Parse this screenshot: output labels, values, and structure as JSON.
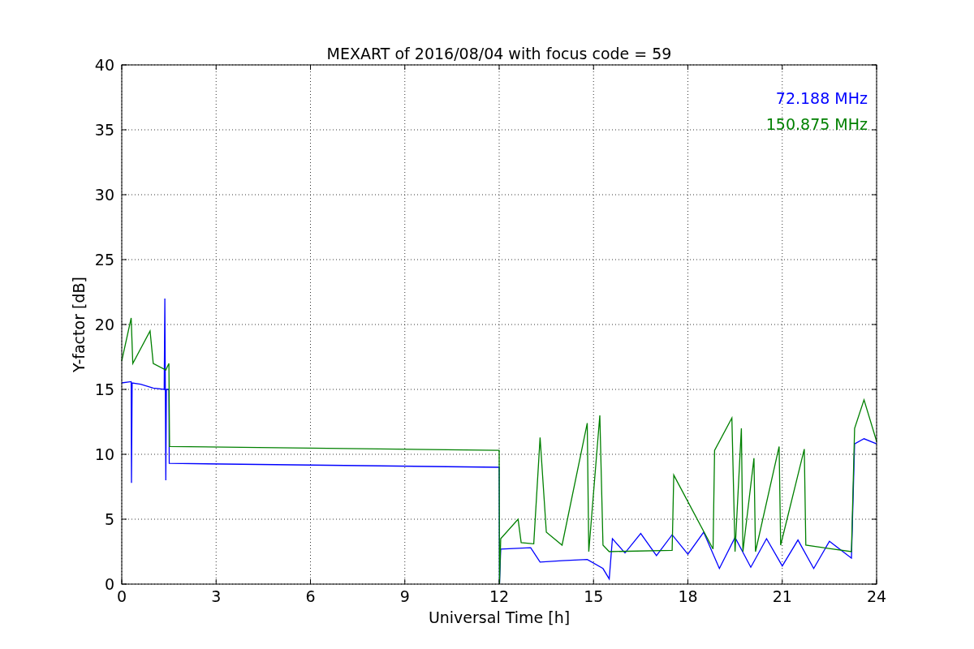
{
  "chart_data": {
    "type": "line",
    "title": "MEXART of 2016/08/04 with focus code = 59",
    "xlabel": "Universal Time [h]",
    "ylabel": "Y-factor [dB]",
    "xlim": [
      0,
      24
    ],
    "ylim": [
      0,
      40
    ],
    "xticks": [
      0,
      3,
      6,
      9,
      12,
      15,
      18,
      21,
      24
    ],
    "yticks": [
      0,
      5,
      10,
      15,
      20,
      25,
      30,
      35,
      40
    ],
    "grid": true,
    "series": [
      {
        "name": "72.188 MHz",
        "color": "#0000ff",
        "x": [
          0,
          0.3,
          0.31,
          0.33,
          0.6,
          1,
          1.35,
          1.37,
          1.4,
          1.42,
          1.5,
          1.51,
          12,
          12.01,
          12.05,
          13,
          13.3,
          14,
          14.8,
          15.3,
          15.5,
          15.6,
          16,
          16.5,
          17,
          17.5,
          18,
          18.5,
          19,
          19.5,
          20,
          20.5,
          21,
          21.5,
          22,
          22.5,
          23.2,
          23.3,
          23.6,
          24
        ],
        "values": [
          15.5,
          15.6,
          7.8,
          15.5,
          15.4,
          15.1,
          15,
          22,
          8,
          15,
          15,
          9.3,
          9,
          0,
          2.7,
          2.8,
          1.7,
          1.8,
          1.9,
          1.2,
          0.4,
          3.5,
          2.4,
          3.9,
          2.2,
          3.8,
          2.3,
          4,
          1.2,
          3.6,
          1.3,
          3.5,
          1.4,
          3.4,
          1.2,
          3.3,
          2,
          10.8,
          11.2,
          10.8
        ]
      },
      {
        "name": "150.875 MHz",
        "color": "#008000",
        "x": [
          0,
          0.3,
          0.35,
          0.9,
          1,
          1.4,
          1.5,
          1.52,
          12,
          12.01,
          12.05,
          12.6,
          12.7,
          13.1,
          13.3,
          13.5,
          14,
          14.8,
          14.85,
          15.1,
          15.2,
          15.3,
          15.5,
          17.5,
          17.55,
          18.8,
          18.85,
          19.4,
          19.5,
          19.7,
          19.75,
          20.1,
          20.15,
          20.9,
          20.95,
          21.7,
          21.75,
          23.2,
          23.3,
          23.6,
          24
        ],
        "values": [
          17.2,
          20.5,
          17,
          19.5,
          17,
          16.5,
          17,
          10.6,
          10.3,
          0,
          3.5,
          5,
          3.2,
          3.1,
          11.3,
          4,
          3,
          12.4,
          2.5,
          10,
          13,
          3,
          2.5,
          2.6,
          8.4,
          2.7,
          10.3,
          12.8,
          2.5,
          12,
          2.5,
          9.7,
          2.5,
          10.6,
          3,
          10.4,
          3,
          2.5,
          12,
          14.2,
          11
        ]
      }
    ]
  }
}
